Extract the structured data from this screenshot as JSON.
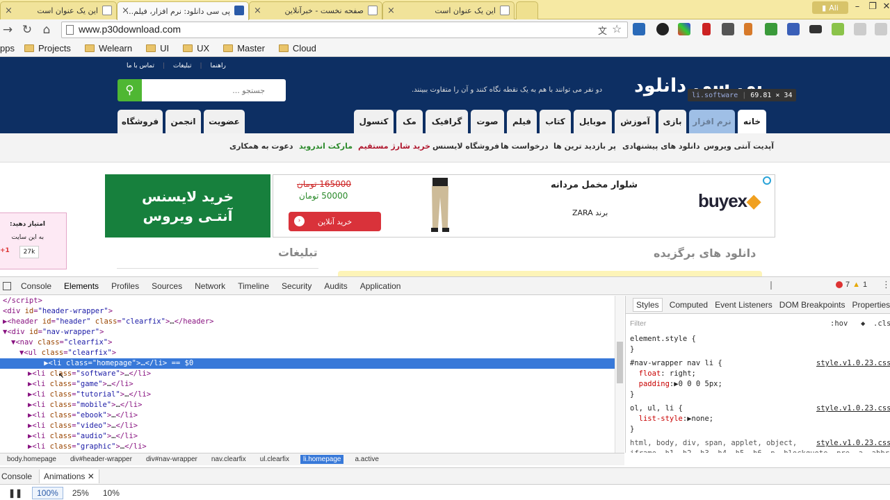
{
  "browser": {
    "tabs": [
      {
        "title": "این یک عنوان است",
        "active": false
      },
      {
        "title": "پی سی دانلود: نرم افزار، فیلم...",
        "active": true
      },
      {
        "title": "صفحه نخست - خبرآنلاین",
        "active": false
      },
      {
        "title": "این یک عنوان است",
        "active": false
      }
    ],
    "user": "Ali",
    "url": "www.p30download.com",
    "bookmarks": [
      "pps",
      "Projects",
      "Welearn",
      "UI",
      "UX",
      "Master",
      "Cloud"
    ]
  },
  "site": {
    "toplinks": [
      "راهنما",
      "تبلیغات",
      "تماس با ما"
    ],
    "search_placeholder": "جستجو ...",
    "slogan": "دو نفر می توانند با هم به یک نقطه نگاه کنند و آن را متفاوت ببینند.",
    "logo": "پی سی دانلود",
    "tooltip": {
      "selector": "li.software",
      "size": "69.81 × 34"
    },
    "nav": [
      "خانه",
      "نرم افزار",
      "بازی",
      "آموزش",
      "موبایل",
      "کتاب",
      "فیلم",
      "صوت",
      "گرافیک",
      "مک",
      "کنسول",
      "عضویت",
      "انجمن",
      "فروشگاه"
    ],
    "subnav": [
      "آپدیت آنتی ویروس",
      "دانلود های پیشنهادی",
      "پر بازدید ترین ها",
      "درخواست ها",
      "فروشگاه لایسنس",
      "خرید شارژ مستقیم",
      "مارکت اندروید",
      "دعوت به همکاری"
    ],
    "banner_license": [
      "خرید لایسنس",
      "آنتـی ویروس"
    ],
    "ad": {
      "brand": "buyex",
      "title": "شلوار مخمل مردانه",
      "subtitle": "برند ZARA",
      "old_price": "165000 تومان",
      "new_price": "50000 تومان",
      "buy": "خرید آنلاین"
    },
    "rate": {
      "title": "امتیاز دهید:",
      "sub": "به این سایت",
      "count": "27k",
      "plus": "+1"
    },
    "section_ads": "تبلیغات",
    "section_featured": "دانلود های برگزیده"
  },
  "devtools": {
    "tabs": [
      "Console",
      "Elements",
      "Profiles",
      "Sources",
      "Network",
      "Timeline",
      "Security",
      "Audits",
      "Application"
    ],
    "errors": "7",
    "warnings": "1",
    "styles_tabs": [
      "Styles",
      "Computed",
      "Event Listeners",
      "DOM Breakpoints",
      "Properties"
    ],
    "filter": "Filter",
    "hov": ":hov",
    "cls": ".cls",
    "breadcrumbs": [
      "body.homepage",
      "div#header-wrapper",
      "div#nav-wrapper",
      "nav.clearfix",
      "ul.clearfix",
      "li.homepage",
      "a.active"
    ],
    "drawer_tabs": [
      "Console",
      "Animations"
    ],
    "speeds": [
      "100%",
      "25%",
      "10%"
    ]
  },
  "colors": {
    "header_bg": "#0d2f63",
    "tab_strip": "#f6e9a3",
    "selection": "#3879d9",
    "search_btn": "#4fb733",
    "license_banner": "#17803d"
  }
}
